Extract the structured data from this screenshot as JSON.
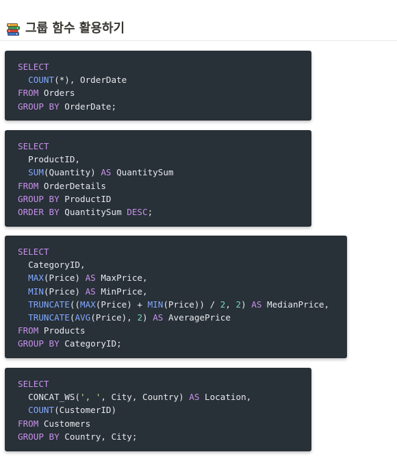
{
  "page": {
    "title": "그룹 함수 활용하기",
    "icon": "books-icon"
  },
  "colors": {
    "code_background": "#283038",
    "keyword": "#c792ea",
    "function": "#82aaff",
    "string": "#c3e88d",
    "number": "#79d3c9",
    "text": "#e8eaed"
  },
  "code_blocks": [
    {
      "lines": [
        [
          [
            "kw",
            "SELECT"
          ]
        ],
        [
          [
            "pl",
            "  "
          ],
          [
            "fn",
            "COUNT"
          ],
          [
            "pl",
            "(*), OrderDate"
          ]
        ],
        [
          [
            "kw",
            "FROM"
          ],
          [
            "pl",
            " Orders"
          ]
        ],
        [
          [
            "kw",
            "GROUP BY"
          ],
          [
            "pl",
            " OrderDate;"
          ]
        ]
      ]
    },
    {
      "lines": [
        [
          [
            "kw",
            "SELECT"
          ]
        ],
        [
          [
            "pl",
            "  ProductID,"
          ]
        ],
        [
          [
            "pl",
            "  "
          ],
          [
            "fn",
            "SUM"
          ],
          [
            "pl",
            "(Quantity) "
          ],
          [
            "kw",
            "AS"
          ],
          [
            "pl",
            " QuantitySum"
          ]
        ],
        [
          [
            "kw",
            "FROM"
          ],
          [
            "pl",
            " OrderDetails"
          ]
        ],
        [
          [
            "kw",
            "GROUP BY"
          ],
          [
            "pl",
            " ProductID"
          ]
        ],
        [
          [
            "kw",
            "ORDER BY"
          ],
          [
            "pl",
            " QuantitySum "
          ],
          [
            "kw",
            "DESC"
          ],
          [
            "pl",
            ";"
          ]
        ]
      ]
    },
    {
      "lines": [
        [
          [
            "kw",
            "SELECT"
          ]
        ],
        [
          [
            "pl",
            "  CategoryID,"
          ]
        ],
        [
          [
            "pl",
            "  "
          ],
          [
            "fn",
            "MAX"
          ],
          [
            "pl",
            "(Price) "
          ],
          [
            "kw",
            "AS"
          ],
          [
            "pl",
            " MaxPrice,"
          ]
        ],
        [
          [
            "pl",
            "  "
          ],
          [
            "fn",
            "MIN"
          ],
          [
            "pl",
            "(Price) "
          ],
          [
            "kw",
            "AS"
          ],
          [
            "pl",
            " MinPrice,"
          ]
        ],
        [
          [
            "pl",
            "  "
          ],
          [
            "fn",
            "TRUNCATE"
          ],
          [
            "pl",
            "(("
          ],
          [
            "fn",
            "MAX"
          ],
          [
            "pl",
            "(Price) + "
          ],
          [
            "fn",
            "MIN"
          ],
          [
            "pl",
            "(Price)) / "
          ],
          [
            "num",
            "2"
          ],
          [
            "pl",
            ", "
          ],
          [
            "num",
            "2"
          ],
          [
            "pl",
            ") "
          ],
          [
            "kw",
            "AS"
          ],
          [
            "pl",
            " MedianPrice,"
          ]
        ],
        [
          [
            "pl",
            "  "
          ],
          [
            "fn",
            "TRUNCATE"
          ],
          [
            "pl",
            "("
          ],
          [
            "fn",
            "AVG"
          ],
          [
            "pl",
            "(Price), "
          ],
          [
            "num",
            "2"
          ],
          [
            "pl",
            ") "
          ],
          [
            "kw",
            "AS"
          ],
          [
            "pl",
            " AveragePrice"
          ]
        ],
        [
          [
            "kw",
            "FROM"
          ],
          [
            "pl",
            " Products"
          ]
        ],
        [
          [
            "kw",
            "GROUP BY"
          ],
          [
            "pl",
            " CategoryID;"
          ]
        ]
      ]
    },
    {
      "lines": [
        [
          [
            "kw",
            "SELECT"
          ]
        ],
        [
          [
            "pl",
            "  CONCAT_WS("
          ],
          [
            "str",
            "', '"
          ],
          [
            "pl",
            ", City, Country) "
          ],
          [
            "kw",
            "AS"
          ],
          [
            "pl",
            " Location,"
          ]
        ],
        [
          [
            "pl",
            "  "
          ],
          [
            "fn",
            "COUNT"
          ],
          [
            "pl",
            "(CustomerID)"
          ]
        ],
        [
          [
            "kw",
            "FROM"
          ],
          [
            "pl",
            " Customers"
          ]
        ],
        [
          [
            "kw",
            "GROUP BY"
          ],
          [
            "pl",
            " Country, City;"
          ]
        ]
      ]
    }
  ]
}
